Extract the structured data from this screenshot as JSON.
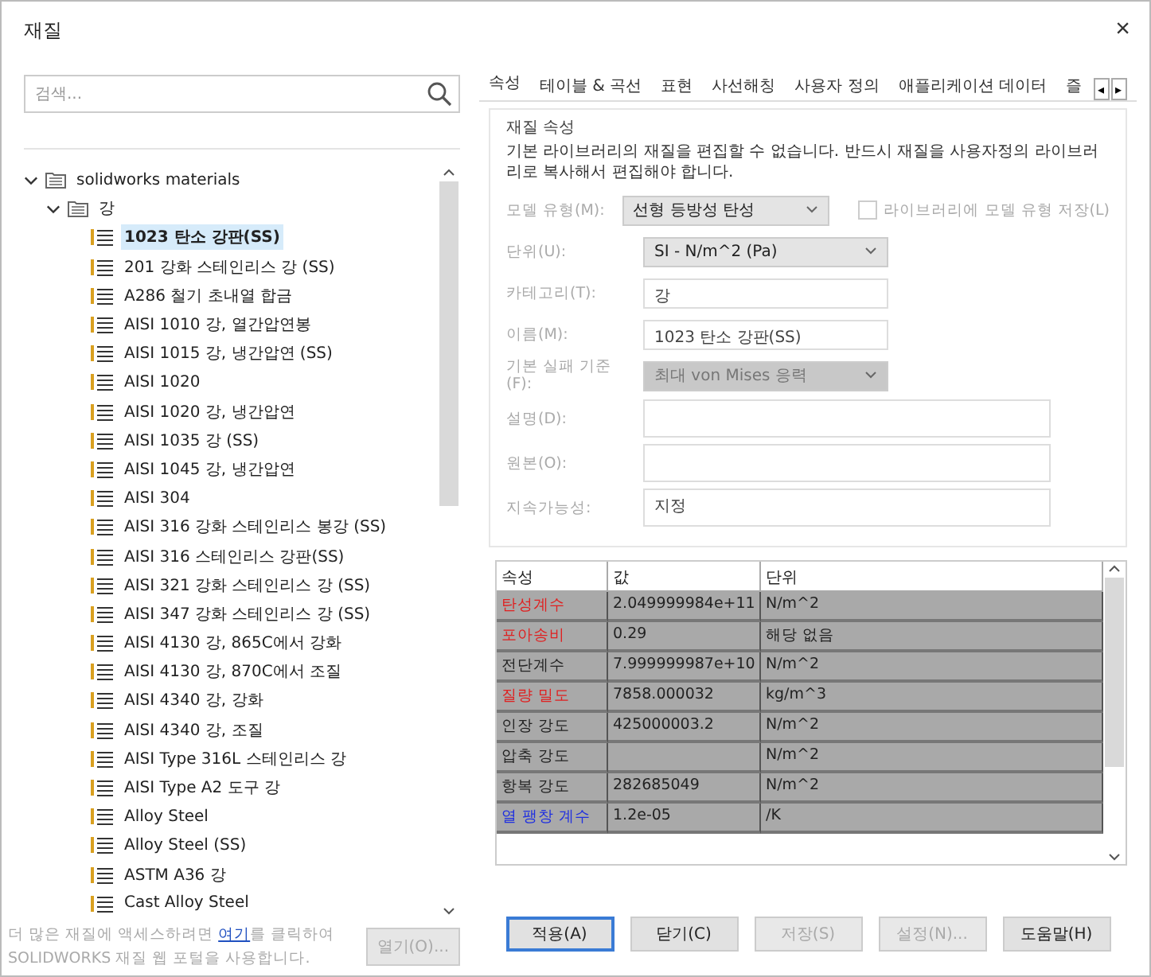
{
  "window": {
    "title": "재질",
    "close": "×"
  },
  "search": {
    "placeholder": "검색..."
  },
  "tree": [
    {
      "label": "solidworks materials",
      "expanded": true,
      "children": [
        {
          "label": "강",
          "expanded": true,
          "children": [
            {
              "label": "1023 탄소 강판(SS)",
              "selected": true
            },
            {
              "label": "201 강화 스테인리스 강 (SS)",
              "selected": false
            },
            {
              "label": "A286 철기 초내열 합금",
              "selected": false
            },
            {
              "label": "AISI 1010 강, 열간압연봉",
              "selected": false
            },
            {
              "label": "AISI 1015 강, 냉간압연 (SS)",
              "selected": false
            },
            {
              "label": "AISI 1020",
              "selected": false
            },
            {
              "label": "AISI 1020 강, 냉간압연",
              "selected": false
            },
            {
              "label": "AISI 1035 강 (SS)",
              "selected": false
            },
            {
              "label": "AISI 1045 강, 냉간압연",
              "selected": false
            },
            {
              "label": "AISI 304",
              "selected": false
            },
            {
              "label": "AISI 316 강화 스테인리스 봉강 (SS)",
              "selected": false
            },
            {
              "label": "AISI 316 스테인리스 강판(SS)",
              "selected": false
            },
            {
              "label": "AISI 321 강화 스테인리스 강 (SS)",
              "selected": false
            },
            {
              "label": "AISI 347 강화 스테인리스 강 (SS)",
              "selected": false
            },
            {
              "label": "AISI 4130 강, 865C에서 강화",
              "selected": false
            },
            {
              "label": "AISI 4130 강, 870C에서 조질",
              "selected": false
            },
            {
              "label": "AISI 4340 강, 강화",
              "selected": false
            },
            {
              "label": "AISI 4340 강, 조질",
              "selected": false
            },
            {
              "label": "AISI Type 316L 스테인리스 강",
              "selected": false
            },
            {
              "label": "AISI Type A2 도구 강",
              "selected": false
            },
            {
              "label": "Alloy Steel",
              "selected": false
            },
            {
              "label": "Alloy Steel (SS)",
              "selected": false
            },
            {
              "label": "ASTM A36 강",
              "selected": false
            },
            {
              "label": "Cast Alloy Steel",
              "selected": false
            }
          ]
        }
      ]
    }
  ],
  "footer": {
    "before": "더 많은 재질에 액세스하려면 ",
    "link": "여기",
    "after": "를 클릭하여 SOLIDWORKS 재질 웹 포털을 사용합니다.",
    "open_button": {
      "label": "열기(O)...",
      "disabled": true
    }
  },
  "tabs": [
    {
      "label": "속성",
      "selected": true
    },
    {
      "label": "테이블 & 곡선",
      "selected": false
    },
    {
      "label": "표현",
      "selected": false
    },
    {
      "label": "사선해칭",
      "selected": false
    },
    {
      "label": "사용자 정의",
      "selected": false
    },
    {
      "label": "애플리케이션 데이터",
      "selected": false
    },
    {
      "label": "즐",
      "selected": false
    }
  ],
  "tab_scroll": [
    "◂",
    "▸"
  ],
  "properties_group": {
    "title": "재질 속성",
    "note": "기본 라이브러리의 재질을 편집할 수 없습니다. 반드시 재질을 사용자정의 라이브러리로 복사해서 편집해야 합니다.",
    "fields": [
      {
        "kind": "select",
        "label": "모델 유형(M):",
        "value": "선형 등방성 탄성",
        "disabled": false
      },
      {
        "kind": "select",
        "label": "단위(U):",
        "value": "SI - N/m^2 (Pa)",
        "disabled": false
      },
      {
        "kind": "text",
        "label": "카테고리(T):",
        "value": "강"
      },
      {
        "kind": "text",
        "label": "이름(M):",
        "value": "1023 탄소 강판(SS)"
      },
      {
        "kind": "select",
        "label": "기본 실패 기준(F):",
        "value": "최대 von Mises 응력",
        "disabled": true
      },
      {
        "kind": "wide",
        "label": "설명(D):"
      },
      {
        "kind": "wide",
        "label": "원본(O):"
      },
      {
        "kind": "wide",
        "label": "지속가능성:",
        "value": "지정"
      }
    ],
    "save_model_type": {
      "label": "라이브러리에 모델 유형 저장(L)",
      "checked": false,
      "disabled": true
    }
  },
  "table": {
    "columns": [
      "속성",
      "값",
      "단위"
    ],
    "rows": [
      {
        "name": "탄성계수",
        "value": "2.049999984e+11",
        "unit": "N/m^2",
        "color": "#e02020"
      },
      {
        "name": "포아송비",
        "value": "0.29",
        "unit": "해당 없음",
        "color": "#e02020"
      },
      {
        "name": "전단계수",
        "value": "7.999999987e+10",
        "unit": "N/m^2",
        "color": "#222222"
      },
      {
        "name": "질량 밀도",
        "value": "7858.000032",
        "unit": "kg/m^3",
        "color": "#e02020"
      },
      {
        "name": "인장 강도",
        "value": "425000003.2",
        "unit": "N/m^2",
        "color": "#222222"
      },
      {
        "name": "압축 강도",
        "value": "",
        "unit": "N/m^2",
        "color": "#222222"
      },
      {
        "name": "항복 강도",
        "value": "282685049",
        "unit": "N/m^2",
        "color": "#222222"
      },
      {
        "name": "열 팽창 계수",
        "value": "1.2e-05",
        "unit": "/K",
        "color": "#2030e0"
      }
    ]
  },
  "buttons": [
    {
      "label": "적용(A)",
      "disabled": false,
      "default": true
    },
    {
      "label": "닫기(C)",
      "disabled": false,
      "default": false
    },
    {
      "label": "저장(S)",
      "disabled": true,
      "default": false
    },
    {
      "label": "설정(N)...",
      "disabled": true,
      "default": false
    },
    {
      "label": "도움말(H)",
      "disabled": false,
      "default": false
    }
  ]
}
